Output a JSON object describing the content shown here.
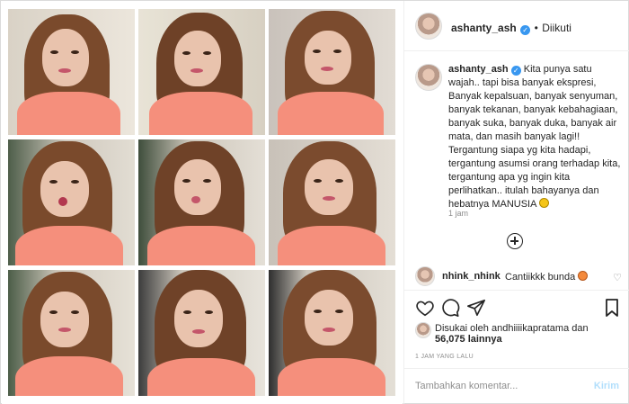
{
  "header": {
    "username": "ashanty_ash",
    "separator": "•",
    "follow_status": "Diikuti",
    "more_icon": "more-options-icon"
  },
  "caption": {
    "username": "ashanty_ash",
    "text": "Kita punya satu wajah.. tapi bisa banyak ekspresi, Banyak kepalsuan, banyak senyuman, banyak tekanan, banyak kebahagiaan, banyak suka, banyak duka, banyak air mata, dan masih banyak lagi!! Tergantung siapa yg kita hadapi, tergantung asumsi orang terhadap kita, tergantung apa yg ingin kita perlihatkan.. itulah bahayanya dan hebatnya MANUSIA",
    "time": "1 jam"
  },
  "comment": {
    "username": "nhink_nhink",
    "text": "Cantiikkk bunda"
  },
  "likes": {
    "line1": "Disukai oleh andhiiiikapratama dan",
    "line2": "56,075 lainnya"
  },
  "post_time": "1 JAM YANG LALU",
  "add_comment": {
    "placeholder": "Tambahkan komentar...",
    "send": "Kirim"
  },
  "colors": {
    "accent": "#3897f0",
    "send_disabled": "#b2dffc",
    "muted": "#8e8e8e",
    "outfit": "#f58f7c"
  }
}
